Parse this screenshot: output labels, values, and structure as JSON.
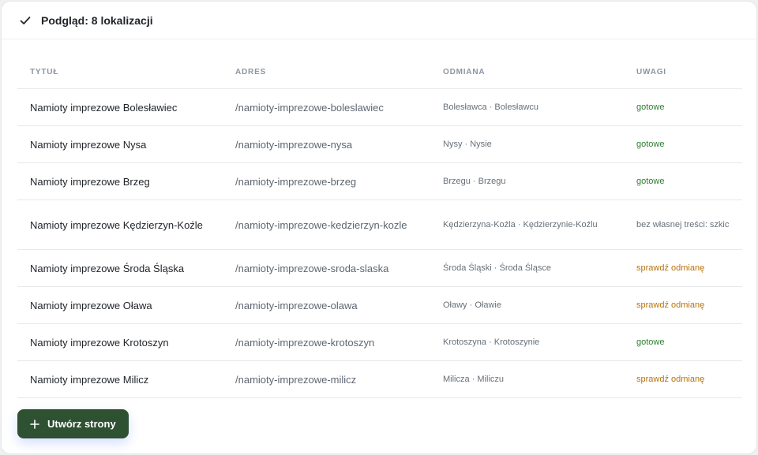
{
  "header": {
    "title": "Podgląd: 8 lokalizacji"
  },
  "table": {
    "columns": [
      "TYTUŁ",
      "ADRES",
      "ODMIANA",
      "UWAGI"
    ],
    "rows": [
      {
        "title": "Namioty imprezowe Bolesławiec",
        "slug": "/namioty-imprezowe-boleslawiec",
        "odmiana": "Bolesławca · Bolesławcu",
        "note": "gotowe",
        "status": "ok"
      },
      {
        "title": "Namioty imprezowe Nysa",
        "slug": "/namioty-imprezowe-nysa",
        "odmiana": "Nysy · Nysie",
        "note": "gotowe",
        "status": "ok"
      },
      {
        "title": "Namioty imprezowe Brzeg",
        "slug": "/namioty-imprezowe-brzeg",
        "odmiana": "Brzegu · Brzegu",
        "note": "gotowe",
        "status": "ok"
      },
      {
        "title": "Namioty imprezowe Kędzierzyn-Koźle",
        "slug": "/namioty-imprezowe-kedzierzyn-kozle",
        "odmiana": "Kędzierzyna-Koźla · Kędzierzynie-Koźlu",
        "note": "bez własnej treści: szkic",
        "status": "neutral"
      },
      {
        "title": "Namioty imprezowe Środa Śląska",
        "slug": "/namioty-imprezowe-sroda-slaska",
        "odmiana": "Środa Śląski · Środa Śląsce",
        "note": "sprawdź odmianę",
        "status": "warn"
      },
      {
        "title": "Namioty imprezowe Oława",
        "slug": "/namioty-imprezowe-olawa",
        "odmiana": "Oławy · Oławie",
        "note": "sprawdź odmianę",
        "status": "warn"
      },
      {
        "title": "Namioty imprezowe Krotoszyn",
        "slug": "/namioty-imprezowe-krotoszyn",
        "odmiana": "Krotoszyna · Krotoszynie",
        "note": "gotowe",
        "status": "ok"
      },
      {
        "title": "Namioty imprezowe Milicz",
        "slug": "/namioty-imprezowe-milicz",
        "odmiana": "Milicza · Miliczu",
        "note": "sprawdź odmianę",
        "status": "warn"
      }
    ]
  },
  "actions": {
    "create_label": "Utwórz strony"
  },
  "icons": {
    "header": "check-icon",
    "create": "plus-icon"
  },
  "colors": {
    "accent": "#2e5132",
    "ok": "#2e7d32",
    "warn": "#b8730a"
  }
}
